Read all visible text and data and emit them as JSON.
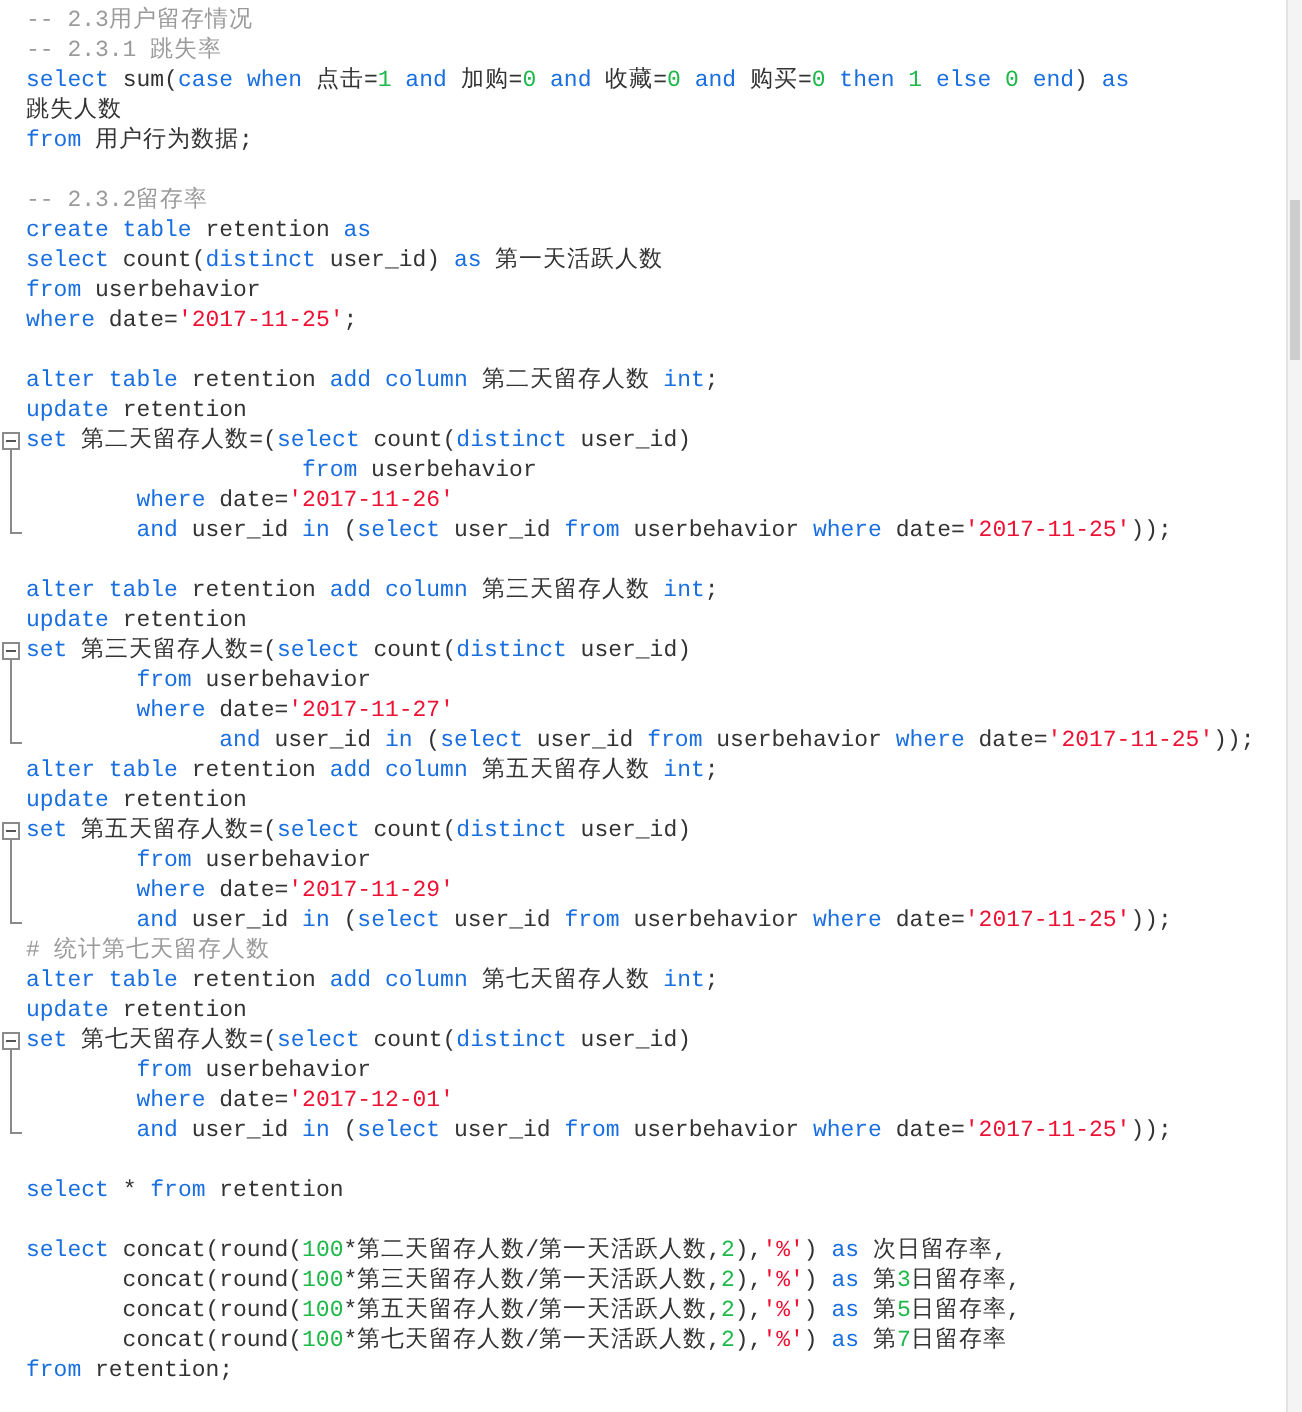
{
  "editor": {
    "blocks": [
      [
        {
          "tokens": [
            {
              "kind": "comment",
              "text": "-- 2.3用户留存情况"
            }
          ]
        },
        {
          "tokens": [
            {
              "kind": "comment",
              "text": "-- 2.3.1 跳失率"
            }
          ]
        },
        {
          "tokens": [
            {
              "kind": "keyword",
              "text": "select"
            },
            {
              "kind": "plain",
              "text": " sum("
            },
            {
              "kind": "keyword",
              "text": "case when"
            },
            {
              "kind": "plain",
              "text": " 点击="
            },
            {
              "kind": "number",
              "text": "1"
            },
            {
              "kind": "keyword",
              "text": " and"
            },
            {
              "kind": "plain",
              "text": " 加购="
            },
            {
              "kind": "number",
              "text": "0"
            },
            {
              "kind": "keyword",
              "text": " and"
            },
            {
              "kind": "plain",
              "text": " 收藏="
            },
            {
              "kind": "number",
              "text": "0"
            },
            {
              "kind": "keyword",
              "text": " and"
            },
            {
              "kind": "plain",
              "text": " 购买="
            },
            {
              "kind": "number",
              "text": "0"
            },
            {
              "kind": "keyword",
              "text": " then"
            },
            {
              "kind": "number",
              "text": " 1"
            },
            {
              "kind": "keyword",
              "text": " else"
            },
            {
              "kind": "number",
              "text": " 0"
            },
            {
              "kind": "keyword",
              "text": " end"
            },
            {
              "kind": "plain",
              "text": ") "
            },
            {
              "kind": "keyword",
              "text": "as"
            }
          ]
        },
        {
          "tokens": [
            {
              "kind": "plain",
              "text": "跳失人数"
            }
          ]
        },
        {
          "tokens": [
            {
              "kind": "keyword",
              "text": "from"
            },
            {
              "kind": "plain",
              "text": " 用户行为数据;"
            }
          ]
        }
      ],
      [
        {
          "tokens": [
            {
              "kind": "comment",
              "text": "-- 2.3.2留存率"
            }
          ]
        },
        {
          "tokens": [
            {
              "kind": "keyword",
              "text": "create table"
            },
            {
              "kind": "plain",
              "text": " retention "
            },
            {
              "kind": "keyword",
              "text": "as"
            }
          ]
        },
        {
          "tokens": [
            {
              "kind": "keyword",
              "text": "select"
            },
            {
              "kind": "plain",
              "text": " count("
            },
            {
              "kind": "keyword",
              "text": "distinct"
            },
            {
              "kind": "plain",
              "text": " user_id) "
            },
            {
              "kind": "keyword",
              "text": "as"
            },
            {
              "kind": "plain",
              "text": " 第一天活跃人数"
            }
          ]
        },
        {
          "tokens": [
            {
              "kind": "keyword",
              "text": "from"
            },
            {
              "kind": "plain",
              "text": " userbehavior"
            }
          ]
        },
        {
          "tokens": [
            {
              "kind": "keyword",
              "text": "where"
            },
            {
              "kind": "plain",
              "text": " date="
            },
            {
              "kind": "string",
              "text": "'2017-11-25'"
            },
            {
              "kind": "plain",
              "text": ";"
            }
          ]
        }
      ],
      [
        {
          "tokens": [
            {
              "kind": "keyword",
              "text": "alter table"
            },
            {
              "kind": "plain",
              "text": " retention "
            },
            {
              "kind": "keyword",
              "text": "add column"
            },
            {
              "kind": "plain",
              "text": " 第二天留存人数 "
            },
            {
              "kind": "keyword",
              "text": "int"
            },
            {
              "kind": "plain",
              "text": ";"
            }
          ]
        },
        {
          "tokens": [
            {
              "kind": "keyword",
              "text": "update"
            },
            {
              "kind": "plain",
              "text": " retention"
            }
          ]
        },
        {
          "expanded": true,
          "tokens": [
            {
              "kind": "keyword",
              "text": "set"
            },
            {
              "kind": "plain",
              "text": " 第二天留存人数=("
            },
            {
              "kind": "keyword",
              "text": "select"
            },
            {
              "kind": "plain",
              "text": " count("
            },
            {
              "kind": "keyword",
              "text": "distinct"
            },
            {
              "kind": "plain",
              "text": " user_id)"
            }
          ],
          "children": [
            {
              "tokens": [
                {
                  "kind": "keyword",
                  "text": "                    from"
                },
                {
                  "kind": "plain",
                  "text": " userbehavior"
                }
              ]
            },
            {
              "tokens": [
                {
                  "kind": "keyword",
                  "text": "        where"
                },
                {
                  "kind": "plain",
                  "text": " date="
                },
                {
                  "kind": "string",
                  "text": "'2017-11-26'"
                }
              ]
            },
            {
              "tokens": [
                {
                  "kind": "keyword",
                  "text": "        and"
                },
                {
                  "kind": "plain",
                  "text": " user_id "
                },
                {
                  "kind": "keyword",
                  "text": "in"
                },
                {
                  "kind": "plain",
                  "text": " ("
                },
                {
                  "kind": "keyword",
                  "text": "select"
                },
                {
                  "kind": "plain",
                  "text": " user_id "
                },
                {
                  "kind": "keyword",
                  "text": "from"
                },
                {
                  "kind": "plain",
                  "text": " userbehavior "
                },
                {
                  "kind": "keyword",
                  "text": "where"
                },
                {
                  "kind": "plain",
                  "text": " date="
                },
                {
                  "kind": "string",
                  "text": "'2017-11-25'"
                },
                {
                  "kind": "plain",
                  "text": "));"
                }
              ]
            }
          ]
        }
      ],
      [
        {
          "tokens": [
            {
              "kind": "keyword",
              "text": "alter table"
            },
            {
              "kind": "plain",
              "text": " retention "
            },
            {
              "kind": "keyword",
              "text": "add column"
            },
            {
              "kind": "plain",
              "text": " 第三天留存人数 "
            },
            {
              "kind": "keyword",
              "text": "int"
            },
            {
              "kind": "plain",
              "text": ";"
            }
          ]
        },
        {
          "tokens": [
            {
              "kind": "keyword",
              "text": "update"
            },
            {
              "kind": "plain",
              "text": " retention"
            }
          ]
        },
        {
          "expanded": true,
          "tokens": [
            {
              "kind": "keyword",
              "text": "set"
            },
            {
              "kind": "plain",
              "text": " 第三天留存人数=("
            },
            {
              "kind": "keyword",
              "text": "select"
            },
            {
              "kind": "plain",
              "text": " count("
            },
            {
              "kind": "keyword",
              "text": "distinct"
            },
            {
              "kind": "plain",
              "text": " user_id)"
            }
          ],
          "children": [
            {
              "tokens": [
                {
                  "kind": "keyword",
                  "text": "        from"
                },
                {
                  "kind": "plain",
                  "text": " userbehavior"
                }
              ]
            },
            {
              "tokens": [
                {
                  "kind": "keyword",
                  "text": "        where"
                },
                {
                  "kind": "plain",
                  "text": " date="
                },
                {
                  "kind": "string",
                  "text": "'2017-11-27'"
                }
              ]
            },
            {
              "tokens": [
                {
                  "kind": "keyword",
                  "text": "              and"
                },
                {
                  "kind": "plain",
                  "text": " user_id "
                },
                {
                  "kind": "keyword",
                  "text": "in"
                },
                {
                  "kind": "plain",
                  "text": " ("
                },
                {
                  "kind": "keyword",
                  "text": "select"
                },
                {
                  "kind": "plain",
                  "text": " user_id "
                },
                {
                  "kind": "keyword",
                  "text": "from"
                },
                {
                  "kind": "plain",
                  "text": " userbehavior "
                },
                {
                  "kind": "keyword",
                  "text": "where"
                },
                {
                  "kind": "plain",
                  "text": " date="
                },
                {
                  "kind": "string",
                  "text": "'2017-11-25'"
                },
                {
                  "kind": "plain",
                  "text": "));"
                }
              ]
            }
          ]
        },
        {
          "tokens": [
            {
              "kind": "keyword",
              "text": "alter table"
            },
            {
              "kind": "plain",
              "text": " retention "
            },
            {
              "kind": "keyword",
              "text": "add column"
            },
            {
              "kind": "plain",
              "text": " 第五天留存人数 "
            },
            {
              "kind": "keyword",
              "text": "int"
            },
            {
              "kind": "plain",
              "text": ";"
            }
          ]
        },
        {
          "tokens": [
            {
              "kind": "keyword",
              "text": "update"
            },
            {
              "kind": "plain",
              "text": " retention"
            }
          ]
        },
        {
          "expanded": true,
          "tokens": [
            {
              "kind": "keyword",
              "text": "set"
            },
            {
              "kind": "plain",
              "text": " 第五天留存人数=("
            },
            {
              "kind": "keyword",
              "text": "select"
            },
            {
              "kind": "plain",
              "text": " count("
            },
            {
              "kind": "keyword",
              "text": "distinct"
            },
            {
              "kind": "plain",
              "text": " user_id)"
            }
          ],
          "children": [
            {
              "tokens": [
                {
                  "kind": "keyword",
                  "text": "        from"
                },
                {
                  "kind": "plain",
                  "text": " userbehavior"
                }
              ]
            },
            {
              "tokens": [
                {
                  "kind": "keyword",
                  "text": "        where"
                },
                {
                  "kind": "plain",
                  "text": " date="
                },
                {
                  "kind": "string",
                  "text": "'2017-11-29'"
                }
              ]
            },
            {
              "tokens": [
                {
                  "kind": "keyword",
                  "text": "        and"
                },
                {
                  "kind": "plain",
                  "text": " user_id "
                },
                {
                  "kind": "keyword",
                  "text": "in"
                },
                {
                  "kind": "plain",
                  "text": " ("
                },
                {
                  "kind": "keyword",
                  "text": "select"
                },
                {
                  "kind": "plain",
                  "text": " user_id "
                },
                {
                  "kind": "keyword",
                  "text": "from"
                },
                {
                  "kind": "plain",
                  "text": " userbehavior "
                },
                {
                  "kind": "keyword",
                  "text": "where"
                },
                {
                  "kind": "plain",
                  "text": " date="
                },
                {
                  "kind": "string",
                  "text": "'2017-11-25'"
                },
                {
                  "kind": "plain",
                  "text": "));"
                }
              ]
            }
          ]
        },
        {
          "tokens": [
            {
              "kind": "comment",
              "text": "# 统计第七天留存人数"
            }
          ]
        },
        {
          "tokens": [
            {
              "kind": "keyword",
              "text": "alter table"
            },
            {
              "kind": "plain",
              "text": " retention "
            },
            {
              "kind": "keyword",
              "text": "add column"
            },
            {
              "kind": "plain",
              "text": " 第七天留存人数 "
            },
            {
              "kind": "keyword",
              "text": "int"
            },
            {
              "kind": "plain",
              "text": ";"
            }
          ]
        },
        {
          "tokens": [
            {
              "kind": "keyword",
              "text": "update"
            },
            {
              "kind": "plain",
              "text": " retention"
            }
          ]
        },
        {
          "expanded": true,
          "tokens": [
            {
              "kind": "keyword",
              "text": "set"
            },
            {
              "kind": "plain",
              "text": " 第七天留存人数=("
            },
            {
              "kind": "keyword",
              "text": "select"
            },
            {
              "kind": "plain",
              "text": " count("
            },
            {
              "kind": "keyword",
              "text": "distinct"
            },
            {
              "kind": "plain",
              "text": " user_id)"
            }
          ],
          "children": [
            {
              "tokens": [
                {
                  "kind": "keyword",
                  "text": "        from"
                },
                {
                  "kind": "plain",
                  "text": " userbehavior"
                }
              ]
            },
            {
              "tokens": [
                {
                  "kind": "keyword",
                  "text": "        where"
                },
                {
                  "kind": "plain",
                  "text": " date="
                },
                {
                  "kind": "string",
                  "text": "'2017-12-01'"
                }
              ]
            },
            {
              "tokens": [
                {
                  "kind": "keyword",
                  "text": "        and"
                },
                {
                  "kind": "plain",
                  "text": " user_id "
                },
                {
                  "kind": "keyword",
                  "text": "in"
                },
                {
                  "kind": "plain",
                  "text": " ("
                },
                {
                  "kind": "keyword",
                  "text": "select"
                },
                {
                  "kind": "plain",
                  "text": " user_id "
                },
                {
                  "kind": "keyword",
                  "text": "from"
                },
                {
                  "kind": "plain",
                  "text": " userbehavior "
                },
                {
                  "kind": "keyword",
                  "text": "where"
                },
                {
                  "kind": "plain",
                  "text": " date="
                },
                {
                  "kind": "string",
                  "text": "'2017-11-25'"
                },
                {
                  "kind": "plain",
                  "text": "));"
                }
              ]
            }
          ]
        }
      ],
      [
        {
          "tokens": [
            {
              "kind": "keyword",
              "text": "select"
            },
            {
              "kind": "plain",
              "text": " * "
            },
            {
              "kind": "keyword",
              "text": "from"
            },
            {
              "kind": "plain",
              "text": " retention"
            }
          ]
        }
      ],
      [
        {
          "tokens": [
            {
              "kind": "keyword",
              "text": "select"
            },
            {
              "kind": "plain",
              "text": " concat(round("
            },
            {
              "kind": "number",
              "text": "100"
            },
            {
              "kind": "plain",
              "text": "*第二天留存人数/第一天活跃人数,"
            },
            {
              "kind": "number",
              "text": "2"
            },
            {
              "kind": "plain",
              "text": "),"
            },
            {
              "kind": "string",
              "text": "'%'"
            },
            {
              "kind": "plain",
              "text": ") "
            },
            {
              "kind": "keyword",
              "text": "as"
            },
            {
              "kind": "plain",
              "text": " 次日留存率,"
            }
          ]
        },
        {
          "tokens": [
            {
              "kind": "plain",
              "text": "       concat(round("
            },
            {
              "kind": "number",
              "text": "100"
            },
            {
              "kind": "plain",
              "text": "*第三天留存人数/第一天活跃人数,"
            },
            {
              "kind": "number",
              "text": "2"
            },
            {
              "kind": "plain",
              "text": "),"
            },
            {
              "kind": "string",
              "text": "'%'"
            },
            {
              "kind": "plain",
              "text": ") "
            },
            {
              "kind": "keyword",
              "text": "as"
            },
            {
              "kind": "plain",
              "text": " 第"
            },
            {
              "kind": "number",
              "text": "3"
            },
            {
              "kind": "plain",
              "text": "日留存率,"
            }
          ]
        },
        {
          "tokens": [
            {
              "kind": "plain",
              "text": "       concat(round("
            },
            {
              "kind": "number",
              "text": "100"
            },
            {
              "kind": "plain",
              "text": "*第五天留存人数/第一天活跃人数,"
            },
            {
              "kind": "number",
              "text": "2"
            },
            {
              "kind": "plain",
              "text": "),"
            },
            {
              "kind": "string",
              "text": "'%'"
            },
            {
              "kind": "plain",
              "text": ") "
            },
            {
              "kind": "keyword",
              "text": "as"
            },
            {
              "kind": "plain",
              "text": " 第"
            },
            {
              "kind": "number",
              "text": "5"
            },
            {
              "kind": "plain",
              "text": "日留存率,"
            }
          ]
        },
        {
          "tokens": [
            {
              "kind": "plain",
              "text": "       concat(round("
            },
            {
              "kind": "number",
              "text": "100"
            },
            {
              "kind": "plain",
              "text": "*第七天留存人数/第一天活跃人数,"
            },
            {
              "kind": "number",
              "text": "2"
            },
            {
              "kind": "plain",
              "text": "),"
            },
            {
              "kind": "string",
              "text": "'%'"
            },
            {
              "kind": "plain",
              "text": ") "
            },
            {
              "kind": "keyword",
              "text": "as"
            },
            {
              "kind": "plain",
              "text": " 第"
            },
            {
              "kind": "number",
              "text": "7"
            },
            {
              "kind": "plain",
              "text": "日留存率"
            }
          ]
        },
        {
          "tokens": [
            {
              "kind": "keyword",
              "text": "from"
            },
            {
              "kind": "plain",
              "text": " retention;"
            }
          ]
        }
      ]
    ]
  }
}
